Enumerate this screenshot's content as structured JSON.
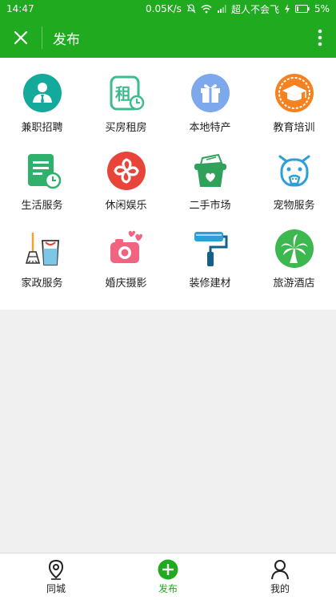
{
  "status": {
    "time": "14:47",
    "speed": "0.05K/s",
    "carrier": "超人不会飞",
    "battery": "5%"
  },
  "header": {
    "title": "发布"
  },
  "categories": [
    {
      "label": "兼职招聘",
      "icon": "person-tie-icon"
    },
    {
      "label": "买房租房",
      "icon": "house-rent-icon"
    },
    {
      "label": "本地特产",
      "icon": "gift-box-icon"
    },
    {
      "label": "教育培训",
      "icon": "graduation-cap-icon"
    },
    {
      "label": "生活服务",
      "icon": "clipboard-clock-icon"
    },
    {
      "label": "休闲娱乐",
      "icon": "pinwheel-icon"
    },
    {
      "label": "二手市场",
      "icon": "basket-heart-icon"
    },
    {
      "label": "宠物服务",
      "icon": "pet-face-icon"
    },
    {
      "label": "家政服务",
      "icon": "broom-cup-icon"
    },
    {
      "label": "婚庆摄影",
      "icon": "camera-hearts-icon"
    },
    {
      "label": "装修建材",
      "icon": "paint-roller-icon"
    },
    {
      "label": "旅游酒店",
      "icon": "palm-tree-icon"
    }
  ],
  "nav": {
    "items": [
      {
        "label": "同城",
        "icon": "location-pin-icon"
      },
      {
        "label": "发布",
        "icon": "plus-circle-icon"
      },
      {
        "label": "我的",
        "icon": "user-icon"
      }
    ]
  },
  "colors": {
    "brand": "#1faa1f"
  }
}
